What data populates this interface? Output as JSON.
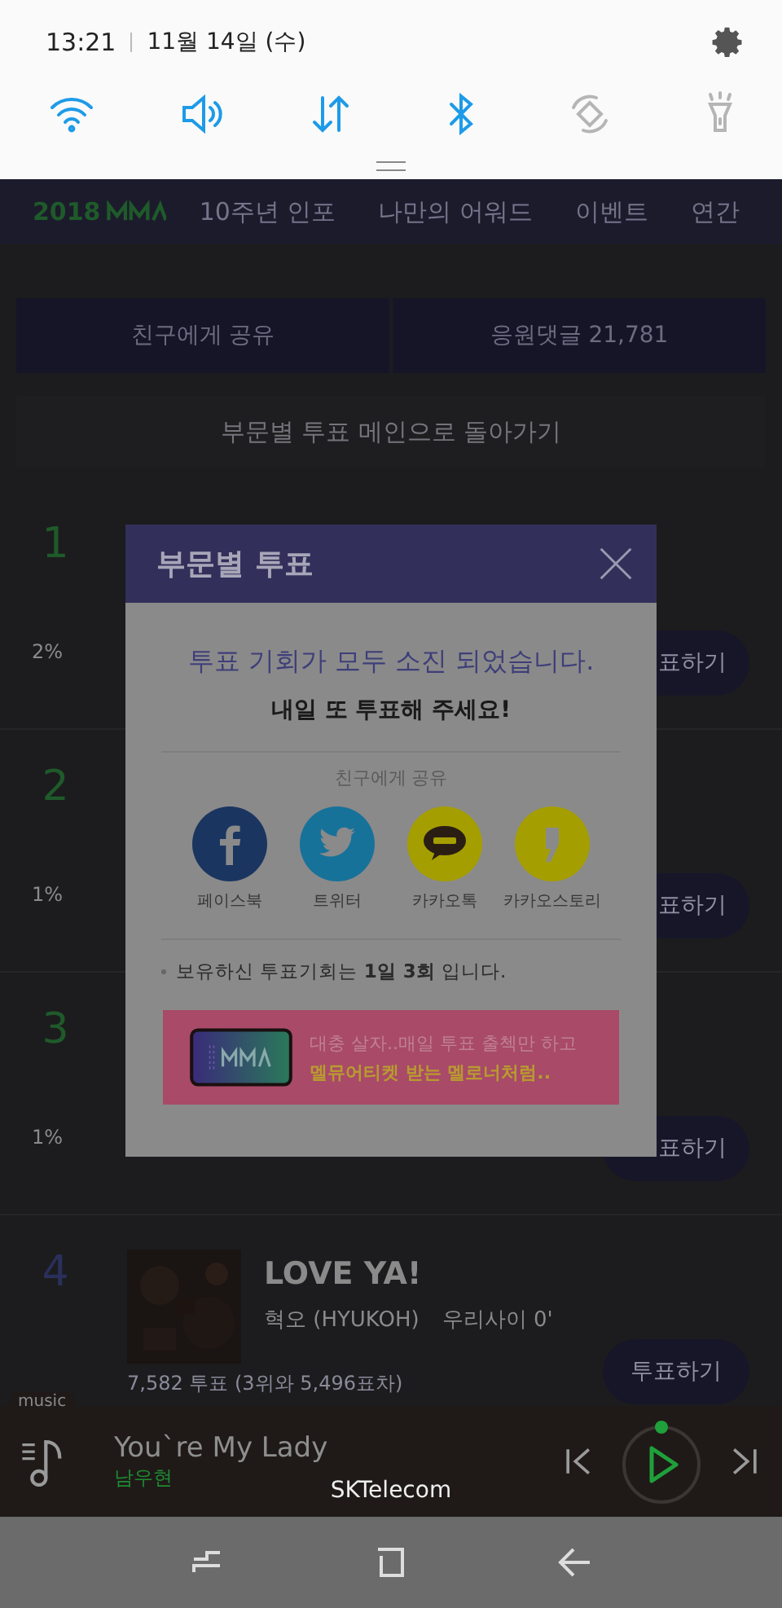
{
  "quick_panel": {
    "time": "13:21",
    "date": "11월 14일 (수)",
    "toggles": [
      {
        "kind": "wifi",
        "on": true
      },
      {
        "kind": "sound",
        "on": true
      },
      {
        "kind": "data",
        "on": true
      },
      {
        "kind": "bluetooth",
        "on": true
      },
      {
        "kind": "rotate",
        "on": false
      },
      {
        "kind": "flashlight",
        "on": false
      }
    ]
  },
  "page": {
    "nav": {
      "year": "2018",
      "tabs": [
        "10주년 인포",
        "나만의 어워드",
        "이벤트",
        "연간"
      ]
    },
    "share_button": "친구에게 공유",
    "comment_button": "응원댓글 21,781",
    "back_link": "부문별 투표 메인으로 돌아가기",
    "rows": [
      {
        "rank": "1",
        "color": "#1f5a2a",
        "percent": "2%",
        "vote_button": "표하기"
      },
      {
        "rank": "2",
        "color": "#1f5a2a",
        "percent": "1%",
        "vote_button": "표하기"
      },
      {
        "rank": "3",
        "color": "#1f5a2a",
        "percent": "1%",
        "vote_button": "표하기"
      },
      {
        "rank": "4",
        "color": "#2a2f5a",
        "title": "LOVE YA!",
        "artist": "혁오 (HYUKOH)",
        "album": "우리사이 0'",
        "votes": "7,582 투표 (3위와 5,496표차)",
        "vote_button": "투표하기"
      }
    ]
  },
  "modal": {
    "title": "부문별 투표",
    "headline": "투표 기회가 모두 소진 되었습니다.",
    "subline": "내일 또 투표해 주세요!",
    "share_label": "친구에게 공유",
    "share": [
      {
        "kind": "facebook",
        "label": "페이스북"
      },
      {
        "kind": "twitter",
        "label": "트위터"
      },
      {
        "kind": "kakaotalk",
        "label": "카카오톡"
      },
      {
        "kind": "kakaostory",
        "label": "카카오스토리"
      }
    ],
    "note": "보유하신 투표기회는 **1일 3회** 입니다.",
    "banner": {
      "line_1": "대충 살자..매일 투표 출첵만 하고",
      "line_2": "멜뮤어티켓 받는 멜로너처럼.."
    }
  },
  "music_player": {
    "tag": "music",
    "title": "You`re My Lady",
    "artist": "남우현",
    "carrier": "SKTelecom"
  }
}
